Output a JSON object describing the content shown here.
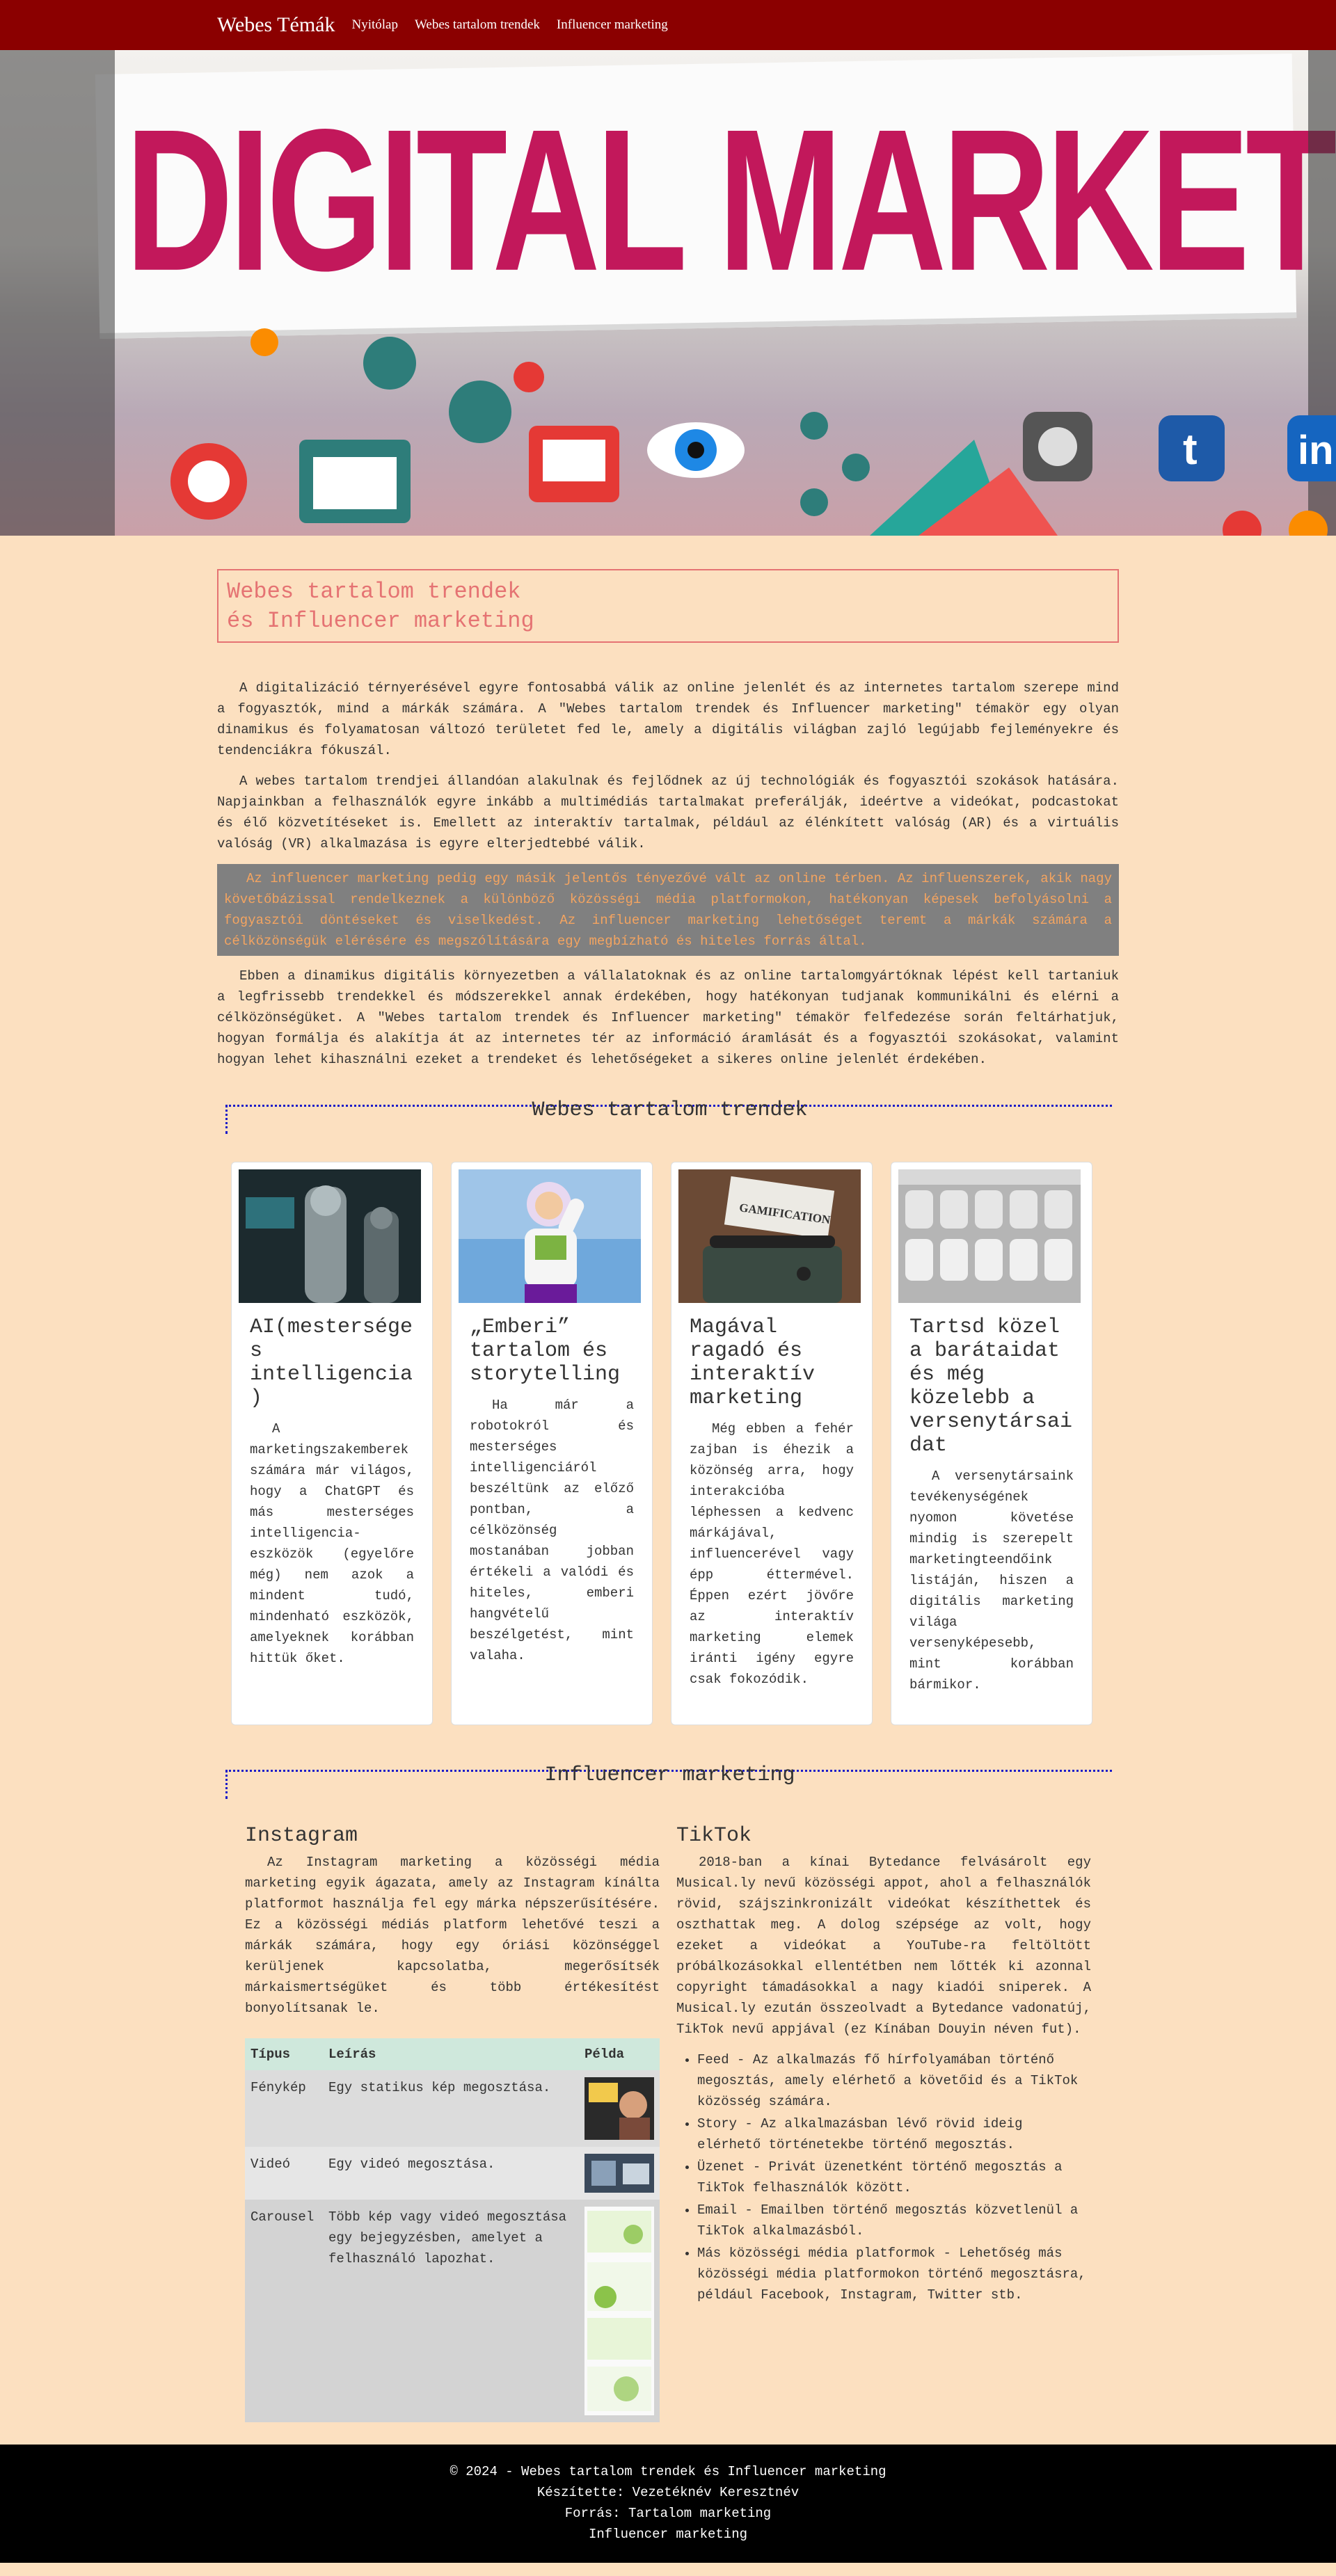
{
  "nav": {
    "brand": "Webes Témák",
    "links": [
      "Nyitólap",
      "Webes tartalom trendek",
      "Influencer marketing"
    ]
  },
  "hero": {
    "image_alt": "DIGITAL MARKETING",
    "banner_text": "DIGITAL MARKETING"
  },
  "page": {
    "title_line1": "Webes tartalom trendek",
    "title_line2": "és Influencer marketing"
  },
  "intro": [
    "A digitalizáció térnyerésével egyre fontosabbá válik az online jelenlét és az internetes tartalom szerepe mind a fogyasztók, mind a márkák számára. A \"Webes tartalom trendek és Influencer marketing\" témakör egy olyan dinamikus és folyamatosan változó területet fed le, amely a digitális világban zajló legújabb fejleményekre és tendenciákra fókuszál.",
    "A webes tartalom trendjei állandóan alakulnak és fejlődnek az új technológiák és fogyasztói szokások hatására. Napjainkban a felhasználók egyre inkább a multimédiás tartalmakat preferálják, ideértve a videókat, podcastokat és élő közvetítéseket is. Emellett az interaktív tartalmak, például az élénkített valóság (AR) és a virtuális valóság (VR) alkalmazása is egyre elterjedtebbé válik."
  ],
  "highlight": "Az influencer marketing pedig egy másik jelentős tényezővé vált az online térben. Az influenszerek, akik nagy követőbázissal rendelkeznek a különböző közösségi média platformokon, hatékonyan képesek befolyásolni a fogyasztói döntéseket és viselkedést. Az influencer marketing lehetőséget teremt a márkák számára a célközönségük elérésére és megszólítására egy megbízható és hiteles forrás által.",
  "outro": "Ebben a dinamikus digitális környezetben a vállalatoknak és az online tartalomgyártóknak lépést kell tartaniuk a legfrissebb trendekkel és módszerekkel annak érdekében, hogy hatékonyan tudjanak kommunikálni és elérni a célközönségüket. A \"Webes tartalom trendek és Influencer marketing\" témakör felfedezése során feltárhatjuk, hogyan formálja és alakítja át az internetes tér az információ áramlását és a fogyasztói szokásokat, valamint hogyan lehet kihasználni ezeket a trendeket és lehetőségeket a sikeres online jelenlét érdekében.",
  "trends": {
    "heading": "Webes tartalom trendek",
    "cards": [
      {
        "title": "AI(mesterséges intelligencia)",
        "text": "A marketingszakemberek számára már világos, hogy a ChatGPT és más mesterséges intelligencia-eszközök (egyelőre még) nem azok a mindent tudó, mindenható eszközök, amelyeknek korábban hittük őket."
      },
      {
        "title": "„Emberi” tartalom és storytelling",
        "text": "Ha már a robotokról és mesterséges intelligenciáról beszéltünk az előző pontban, a célközönség mostanában jobban értékeli a valódi és hiteles, emberi hangvételű beszélgetést, mint valaha."
      },
      {
        "title": "Magával ragadó és interaktív marketing",
        "text": "Még ebben a fehér zajban is éhezik a közönség arra, hogy interakcióba léphessen a kedvenc márkájával, influencerével vagy épp éttermével. Éppen ezért jövőre az interaktív marketing elemek iránti igény egyre csak fokozódik."
      },
      {
        "title": "Tartsd közel a barátaidat és még közelebb a versenytársaidat",
        "text": "A versenytársaink tevékenységének nyomon követése mindig is szerepelt marketingteendőink listáján, hiszen a digitális marketing világa versenyképesebb, mint korábban bármikor."
      }
    ]
  },
  "influencer": {
    "heading": "Influencer marketing",
    "instagram": {
      "title": "Instagram",
      "text": "Az Instagram marketing a közösségi média marketing egyik ágazata, amely az Instagram kínálta platformot használja fel egy márka népszerűsítésére. Ez a közösségi médiás platform lehetővé teszi a márkák számára, hogy egy óriási közönséggel kerüljenek kapcsolatba, megerősítsék márkaismertségüket és több értékesítést bonyolítsanak le.",
      "table": {
        "headers": [
          "Típus",
          "Leírás",
          "Példa"
        ],
        "rows": [
          {
            "type": "Fénykép",
            "desc": "Egy statikus kép megosztása."
          },
          {
            "type": "Videó",
            "desc": "Egy videó megosztása."
          },
          {
            "type": "Carousel",
            "desc": "Több kép vagy videó megosztása egy bejegyzésben, amelyet a felhasználó lapozhat."
          }
        ]
      }
    },
    "tiktok": {
      "title": "TikTok",
      "text": "2018-ban a kínai Bytedance felvásárolt egy Musical.ly nevű közösségi appot, ahol a felhasználók rövid, szájszinkronizált videókat készíthettek és oszthattak meg. A dolog szépsége az volt, hogy ezeket a videókat a YouTube-ra feltöltött próbálkozásokkal ellentétben nem lőtték ki azonnal copyright támadásokkal a nagy kiadói sniperek. A Musical.ly ezután összeolvadt a Bytedance vadonatúj, TikTok nevű appjával (ez Kínában Douyin néven fut).",
      "features": [
        "Feed - Az alkalmazás fő hírfolyamában történő megosztás, amely elérhető a követőid és a TikTok közösség számára.",
        "Story - Az alkalmazásban lévő rövid ideig elérhető történetekbe történő megosztás.",
        "Üzenet - Privát üzenetként történő megosztás a TikTok felhasználók között.",
        "Email - Emailben történő megosztás közvetlenül a TikTok alkalmazásból.",
        "Más közösségi média platformok - Lehetőség más közösségi média platformokon történő megosztásra, például Facebook, Instagram, Twitter stb."
      ]
    }
  },
  "footer": {
    "line1": "© 2024 - Webes tartalom trendek és Influencer marketing",
    "line2": "Készítette: Vezetéknév Keresztnév",
    "line3": "Forrás: Tartalom marketing",
    "line4": "Influencer marketing"
  }
}
